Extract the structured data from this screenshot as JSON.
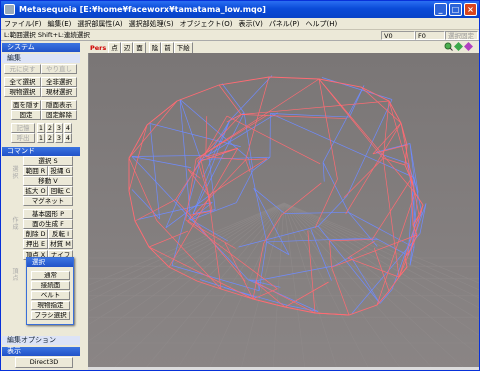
{
  "window": {
    "title": "Metasequoia [E:¥home¥faceworx¥tamatama_low.mqo]",
    "controls": [
      "_",
      "□",
      "×"
    ]
  },
  "menu": {
    "items": [
      "ファイル(F)",
      "編集(E)",
      "選択部属性(A)",
      "選択部処理(S)",
      "オブジェクト(O)",
      "表示(V)",
      "パネル(P)",
      "ヘルプ(H)"
    ]
  },
  "statusbar": {
    "hint": "L:範囲選択  Shift+L:連続選択",
    "v_label": "V0",
    "f_label": "F0",
    "fixed_label": "選択固定"
  },
  "panel": {
    "system_title": "システム",
    "edit_title": "編集",
    "undo": "元に戻す",
    "redo": "やり直し",
    "select_all": "全て選択",
    "deselect_all": "全非選択",
    "select_current": "現物選択",
    "deselect_current": "現材選択",
    "hide_face": "面を隠す",
    "show_face": "隠面表示",
    "fix": "固定",
    "unfix": "固定解除",
    "memory": "記憶",
    "recall": "呼出",
    "slots": [
      "1",
      "2",
      "3",
      "4"
    ],
    "command_title": "コマンド",
    "side_select": "選択",
    "side_create": "作成",
    "side_vertex": "頂点",
    "select_s": "選択 S",
    "range_r": "範囲 R",
    "lasso_g": "投縄 G",
    "move_v": "移動 V",
    "scale_o": "拡大 O",
    "rotate_c": "回転 C",
    "magnet": "マグネット",
    "basic_shape": "基本図形 P",
    "face_gen": "面の生成 F",
    "delete_d": "削除 D",
    "reverse_i": "反転 I",
    "extrude_e": "押出 E",
    "material_m": "材質 M",
    "vertex_x": "頂点 X",
    "knife": "ナイフ",
    "edit_option_title": "編集オプション",
    "display_title": "表示",
    "direct3d": "Direct3D"
  },
  "popup": {
    "title": "選択",
    "items": [
      "通常",
      "接続面",
      "ベルト",
      "現物指定",
      "ブラシ選択"
    ]
  },
  "view": {
    "tabs": [
      "Pers",
      "点",
      "辺",
      "面",
      "陰",
      "前",
      "下絵"
    ],
    "active_tab": "Pers"
  },
  "colors": {
    "accent": "#0a4bd8",
    "wire_red": "#ff6b73",
    "wire_blue": "#6f8bff",
    "viewport_bg": "#7f7a7a"
  }
}
